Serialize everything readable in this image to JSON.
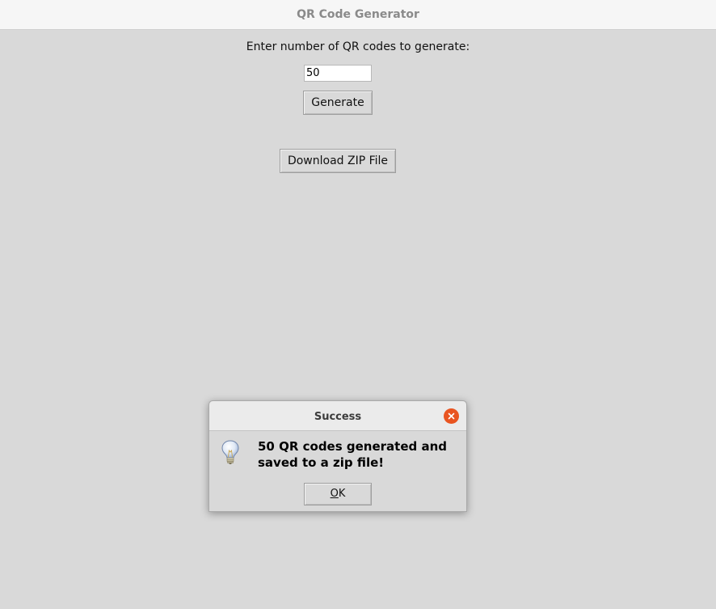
{
  "window": {
    "title": "QR Code Generator"
  },
  "main": {
    "prompt_label": "Enter number of QR codes to generate:",
    "count_input_value": "50",
    "generate_label": "Generate",
    "download_label": "Download ZIP File"
  },
  "dialog": {
    "title": "Success",
    "message": "50 QR codes generated and\nsaved to a zip file!",
    "ok_mnemonic": "O",
    "ok_rest": "K",
    "icon": "lightbulb-icon",
    "close_icon": "close-icon"
  },
  "colors": {
    "background": "#d9d9d9",
    "close_button": "#e95420",
    "titlebar": "#f6f6f6"
  }
}
